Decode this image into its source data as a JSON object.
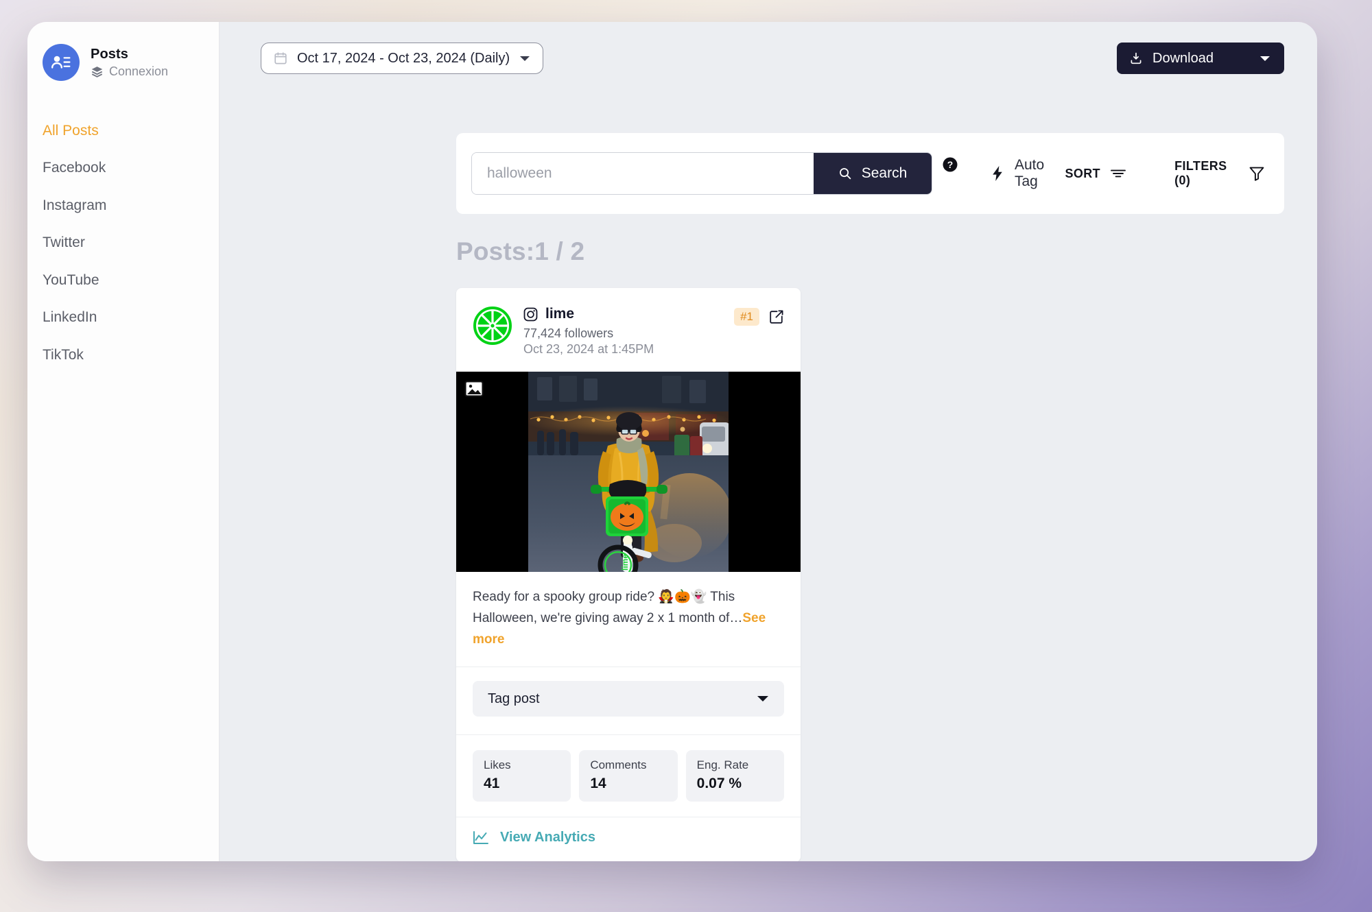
{
  "sidebar": {
    "brand": {
      "avatar_icon": "user-list-icon",
      "title": "Posts",
      "sub_icon": "layers-icon",
      "sub_label": "Connexion"
    },
    "items": [
      {
        "label": "All Posts",
        "active": true
      },
      {
        "label": "Facebook",
        "active": false
      },
      {
        "label": "Instagram",
        "active": false
      },
      {
        "label": "Twitter",
        "active": false
      },
      {
        "label": "YouTube",
        "active": false
      },
      {
        "label": "LinkedIn",
        "active": false
      },
      {
        "label": "TikTok",
        "active": false
      }
    ]
  },
  "topbar": {
    "date_range": {
      "icon": "calendar-icon",
      "label": "Oct 17, 2024 - Oct 23, 2024 (Daily)",
      "caret_icon": "chevron-down-icon"
    },
    "download": {
      "icon": "download-icon",
      "label": "Download",
      "caret_icon": "chevron-down-icon"
    }
  },
  "toolbar": {
    "search": {
      "icon": "search-icon",
      "value": "halloween",
      "placeholder": "halloween",
      "button_label": "Search"
    },
    "help_icon": "help-circle-icon",
    "auto_tag": {
      "icon": "lightning-bolt-icon",
      "label": "Auto Tag"
    },
    "sort": {
      "label": "SORT",
      "icon": "sort-lines-icon"
    },
    "filters": {
      "label": "FILTERS (0)",
      "icon": "funnel-icon"
    }
  },
  "main": {
    "posts_heading_label": "Posts:",
    "posts_heading_count": "1 / 2"
  },
  "post": {
    "avatar_icon": "lime-logo-icon",
    "network_icon": "instagram-icon",
    "account_name": "lime",
    "followers": "77,424 followers",
    "timestamp": "Oct 23, 2024 at 1:45PM",
    "rank_badge": "#1",
    "external_link_icon": "external-link-icon",
    "media_badge_icon": "image-icon",
    "media_alt": "Person in yellow raincoat riding a green Lime e-bike with a jack-o-lantern basket on a city street at dusk",
    "caption_text": "Ready for a spooky group ride? 🧛🎃👻 This Halloween, we're giving away 2 x 1 month of…",
    "see_more_label": "See more",
    "tag_select": {
      "label": "Tag post",
      "caret_icon": "chevron-down-icon"
    },
    "metrics": [
      {
        "label": "Likes",
        "value": "41"
      },
      {
        "label": "Comments",
        "value": "14"
      },
      {
        "label": "Eng. Rate",
        "value": "0.07 %"
      }
    ],
    "analytics": {
      "icon": "line-chart-icon",
      "label": "View Analytics"
    }
  },
  "colors": {
    "accent_orange": "#f0a32c",
    "brand_blue": "#4a72df",
    "dark_navy": "#1b1b33",
    "teal": "#46aab4",
    "lime_green": "#00d215",
    "badge_bg": "#fde9cc"
  }
}
